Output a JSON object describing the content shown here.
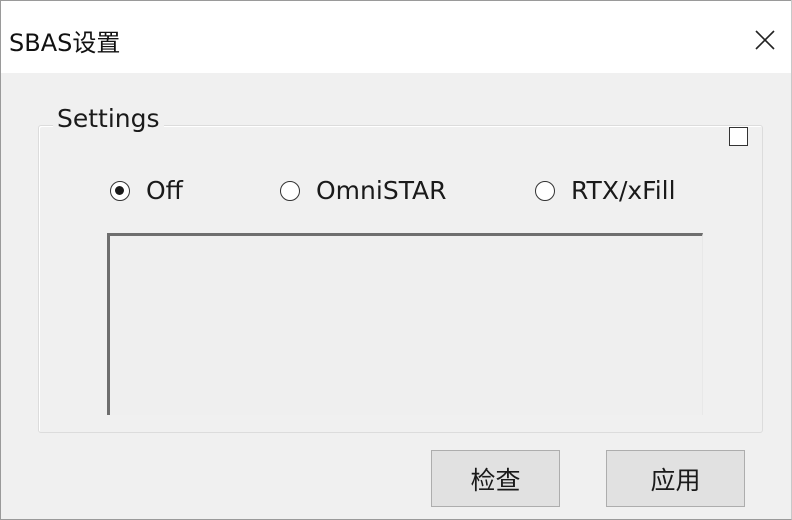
{
  "window": {
    "title": "SBAS设置",
    "close_glyph": "✕"
  },
  "settings": {
    "group_label": "Settings",
    "checkbox_checked": false,
    "radio_options": [
      {
        "label": "Off",
        "selected": true
      },
      {
        "label": "OmniSTAR",
        "selected": false
      },
      {
        "label": "RTX/xFill",
        "selected": false
      }
    ]
  },
  "buttons": {
    "check_label": "检查",
    "apply_label": "应用"
  }
}
